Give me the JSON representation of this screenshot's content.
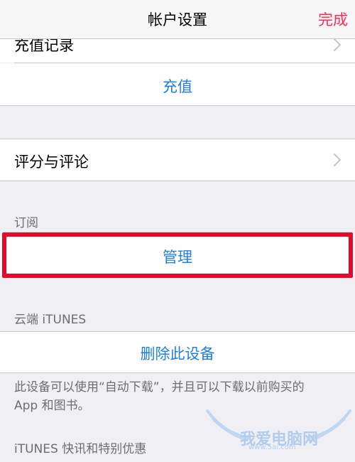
{
  "nav": {
    "title": "帐户设置",
    "done_label": "完成"
  },
  "purchase": {
    "history_label": "充值记录",
    "recharge_label": "充值"
  },
  "ratings": {
    "label": "评分与评论"
  },
  "subscriptions": {
    "header": "订阅",
    "manage_label": "管理"
  },
  "itunes_cloud": {
    "header": "云端 iTUNES",
    "remove_device_label": "删除此设备",
    "footer_line1": "此设备可以使用“自动下载”，并且可以下载以前购买的",
    "footer_line2": "App 和图书。"
  },
  "newsletter": {
    "header": "iTUNES 快讯和特别优惠"
  },
  "watermark": {
    "text": "我爱电脑网",
    "sub": "www.5ai.com"
  },
  "colors": {
    "accent": "#1f7fe5",
    "done": "#ff2d55",
    "highlight": "#e8082a",
    "background": "#efeff4"
  }
}
